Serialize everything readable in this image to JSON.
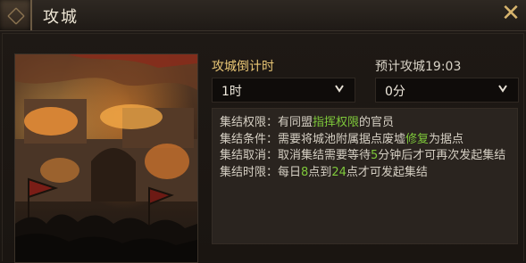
{
  "header": {
    "title": "攻城",
    "close_label": "✕"
  },
  "countdown": {
    "label": "攻城倒计时",
    "hours_value": "1时",
    "minutes_value": "0分"
  },
  "planned": {
    "label": "预计攻城19:03"
  },
  "rules": {
    "line1_prefix": "集结权限：有同盟",
    "line1_highlight": "指挥权限",
    "line1_suffix": "的官员",
    "line2_prefix": "集结条件：需要将城池附属据点废墟",
    "line2_highlight": "修复",
    "line2_suffix": "为据点",
    "line3_prefix": "集结取消：取消集结需要等待",
    "line3_highlight": "5",
    "line3_suffix": "分钟后才可再次发起集结",
    "line4_prefix": "集结时限：每日",
    "line4_highlight1": "8",
    "line4_mid": "点到",
    "line4_highlight2": "24",
    "line4_suffix": "点才可发起集结"
  },
  "colors": {
    "accent_gold": "#e9c675",
    "highlight_green": "#7ec83a"
  }
}
